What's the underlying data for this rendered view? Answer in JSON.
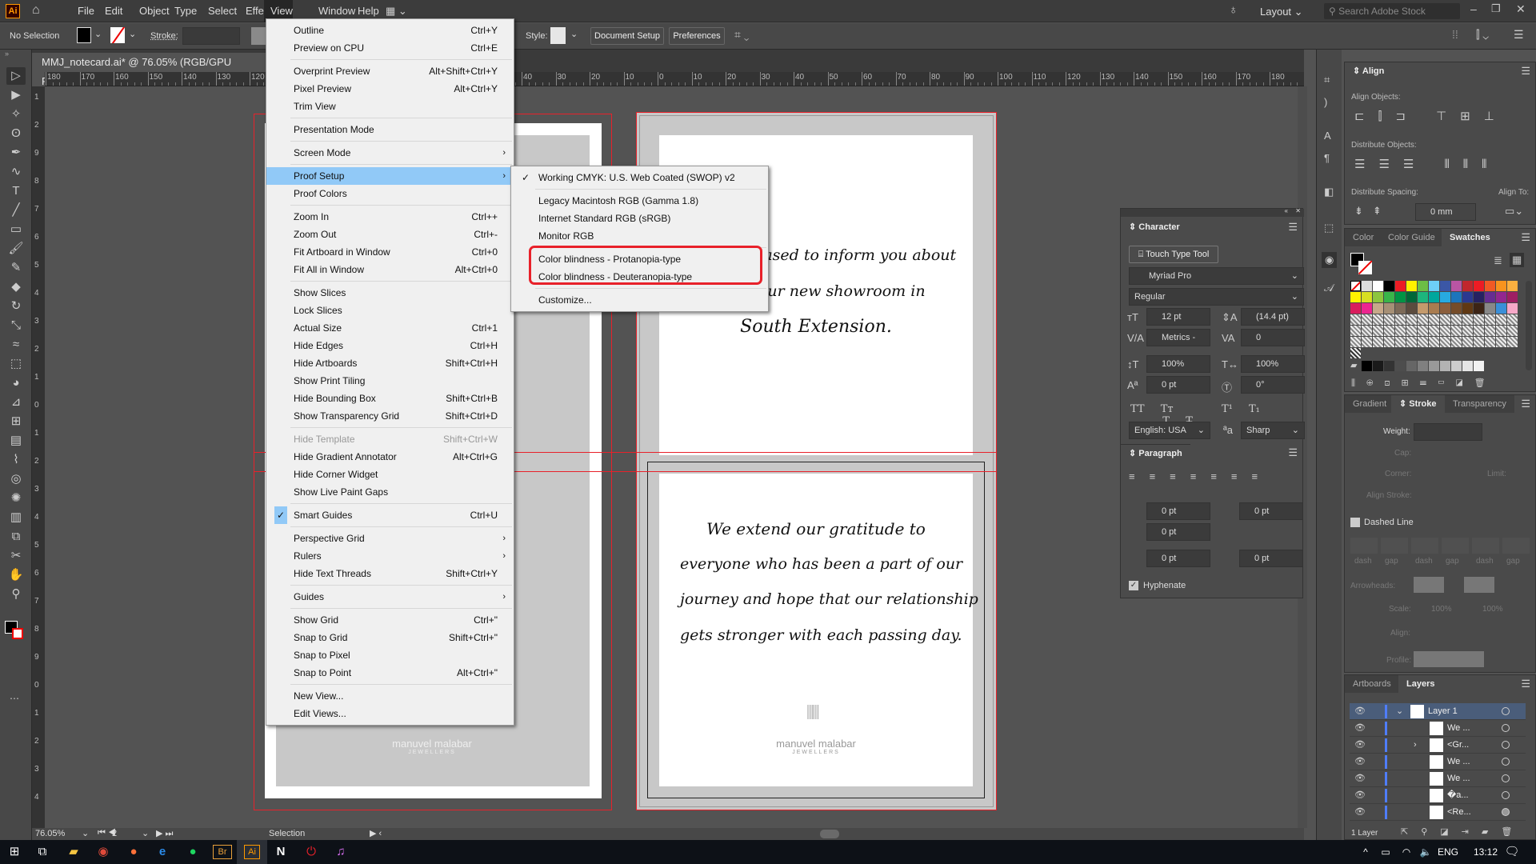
{
  "app": {
    "logo": "Ai",
    "menus": [
      "File",
      "Edit",
      "Object",
      "Type",
      "Select",
      "Effect",
      "View",
      "Window",
      "Help"
    ],
    "active_menu": "View",
    "layout_label": "Layout",
    "search_placeholder": "Search Adobe Stock"
  },
  "control": {
    "selection": "No Selection",
    "stroke_label": "Stroke:",
    "style_label": "Style:",
    "document_setup": "Document Setup",
    "preferences": "Preferences"
  },
  "document": {
    "tab_title": "MMJ_notecard.ai* @ 76.05% (RGB/GPU Preview)",
    "close": "×"
  },
  "rulers": {
    "h_labels": [
      "180",
      "170",
      "160",
      "150",
      "140",
      "130",
      "120",
      "110",
      "100",
      "90",
      "80",
      "70",
      "60",
      "50",
      "40",
      "30",
      "20",
      "10",
      "0",
      "10",
      "20",
      "30",
      "40",
      "50",
      "60",
      "70",
      "80",
      "90",
      "100",
      "110",
      "120",
      "130",
      "140",
      "150",
      "160",
      "170",
      "180",
      "190"
    ],
    "v_labels": [
      "1",
      "2",
      "9",
      "8",
      "7",
      "6",
      "5",
      "4",
      "3",
      "2",
      "1",
      "0",
      "1",
      "2",
      "3",
      "4",
      "5",
      "6",
      "7",
      "8",
      "9",
      "0",
      "1",
      "2",
      "3",
      "4"
    ]
  },
  "tools": [
    "selection-tool",
    "direct-selection-tool",
    "magic-wand-tool",
    "lasso-tool",
    "pen-tool",
    "curvature-tool",
    "type-tool",
    "line-tool",
    "rectangle-tool",
    "paintbrush-tool",
    "blob-brush-tool",
    "eraser-tool",
    "rotate-tool",
    "scale-tool",
    "warp-tool",
    "free-transform-tool",
    "shape-builder-tool",
    "perspective-grid-tool",
    "mesh-tool",
    "gradient-tool",
    "eyedropper-tool",
    "blend-tool",
    "symbol-sprayer-tool",
    "column-graph-tool",
    "artboard-tool",
    "slice-tool",
    "hand-tool",
    "zoom-tool"
  ],
  "artwork": {
    "top_text": [
      "pleased to inform you about",
      "of our new showroom in",
      "South Extension."
    ],
    "bottom_text": [
      "We extend our gratitude to",
      "everyone who has been a part of our",
      "journey and hope that our relationship",
      "gets stronger with each passing day."
    ],
    "logo_name": "manuvel malabar",
    "logo_sub": "JEWELLERS"
  },
  "view_menu": [
    {
      "label": "Outline",
      "shortcut": "Ctrl+Y"
    },
    {
      "label": "Preview on CPU",
      "shortcut": "Ctrl+E"
    },
    {
      "sep": true
    },
    {
      "label": "Overprint Preview",
      "shortcut": "Alt+Shift+Ctrl+Y"
    },
    {
      "label": "Pixel Preview",
      "shortcut": "Alt+Ctrl+Y"
    },
    {
      "label": "Trim View"
    },
    {
      "sep": true
    },
    {
      "label": "Presentation Mode"
    },
    {
      "sep": true
    },
    {
      "label": "Screen Mode",
      "submenu": true
    },
    {
      "sep": true
    },
    {
      "label": "Proof Setup",
      "submenu": true,
      "highlighted": true
    },
    {
      "label": "Proof Colors"
    },
    {
      "sep": true
    },
    {
      "label": "Zoom In",
      "shortcut": "Ctrl++"
    },
    {
      "label": "Zoom Out",
      "shortcut": "Ctrl+-"
    },
    {
      "label": "Fit Artboard in Window",
      "shortcut": "Ctrl+0"
    },
    {
      "label": "Fit All in Window",
      "shortcut": "Alt+Ctrl+0"
    },
    {
      "sep": true
    },
    {
      "label": "Show Slices"
    },
    {
      "label": "Lock Slices"
    },
    {
      "label": "Actual Size",
      "shortcut": "Ctrl+1"
    },
    {
      "label": "Hide Edges",
      "shortcut": "Ctrl+H"
    },
    {
      "label": "Hide Artboards",
      "shortcut": "Shift+Ctrl+H"
    },
    {
      "label": "Show Print Tiling"
    },
    {
      "label": "Hide Bounding Box",
      "shortcut": "Shift+Ctrl+B"
    },
    {
      "label": "Show Transparency Grid",
      "shortcut": "Shift+Ctrl+D"
    },
    {
      "sep": true
    },
    {
      "label": "Hide Template",
      "shortcut": "Shift+Ctrl+W",
      "disabled": true
    },
    {
      "label": "Hide Gradient Annotator",
      "shortcut": "Alt+Ctrl+G"
    },
    {
      "label": "Hide Corner Widget"
    },
    {
      "label": "Show Live Paint Gaps"
    },
    {
      "sep": true
    },
    {
      "label": "Smart Guides",
      "shortcut": "Ctrl+U",
      "checked": true
    },
    {
      "sep": true
    },
    {
      "label": "Perspective Grid",
      "submenu": true
    },
    {
      "label": "Rulers",
      "submenu": true
    },
    {
      "label": "Hide Text Threads",
      "shortcut": "Shift+Ctrl+Y"
    },
    {
      "sep": true
    },
    {
      "label": "Guides",
      "submenu": true
    },
    {
      "sep": true
    },
    {
      "label": "Show Grid",
      "shortcut": "Ctrl+\""
    },
    {
      "label": "Snap to Grid",
      "shortcut": "Shift+Ctrl+\""
    },
    {
      "label": "Snap to Pixel"
    },
    {
      "label": "Snap to Point",
      "shortcut": "Alt+Ctrl+\""
    },
    {
      "sep": true
    },
    {
      "label": "New View..."
    },
    {
      "label": "Edit Views..."
    }
  ],
  "proof_setup_menu": [
    {
      "label": "Working CMYK: U.S. Web Coated (SWOP) v2",
      "checked": true
    },
    {
      "sep": true
    },
    {
      "label": "Legacy Macintosh RGB (Gamma 1.8)"
    },
    {
      "label": "Internet Standard RGB (sRGB)"
    },
    {
      "label": "Monitor RGB"
    },
    {
      "sep": true
    },
    {
      "label": "Color blindness - Protanopia-type"
    },
    {
      "label": "Color blindness - Deuteranopia-type"
    },
    {
      "sep": true
    },
    {
      "label": "Customize..."
    }
  ],
  "highlight_color": "#e8212a",
  "align_panel": {
    "title": "Align",
    "align_objects": "Align Objects:",
    "distribute_objects": "Distribute Objects:",
    "distribute_spacing": "Distribute Spacing:",
    "align_to": "Align To:",
    "spacing_value": "0 mm"
  },
  "swatches_panel": {
    "tabs": [
      "Color",
      "Color Guide",
      "Swatches"
    ],
    "active": "Swatches",
    "colors": [
      "#ffffff",
      "#000000",
      "#ed1c24",
      "#fff200",
      "#6cbe45",
      "#6dcff6",
      "#3b57a6",
      "#b955a4",
      "#c1272d",
      "#ed1c24",
      "#f15a24",
      "#f7931e",
      "#fbb040",
      "#fff200",
      "#d7df23",
      "#8dc63f",
      "#39b54a",
      "#009444",
      "#006838",
      "#1cb67d",
      "#00a79d",
      "#27aae1",
      "#1c75bc",
      "#2b3990",
      "#262262",
      "#662d91",
      "#92278f",
      "#9e1f63",
      "#d91c5c",
      "#ec268f",
      "#c7a98a",
      "#a69076",
      "#7c6a58",
      "#5b4b3e",
      "#c49a6c",
      "#a97c50",
      "#8b5e3c",
      "#754c29",
      "#603813",
      "#3c2415",
      "#888888",
      "#3a8fd8",
      "#f7a8c8"
    ],
    "grays": [
      "#000000",
      "#1a1a1a",
      "#333333",
      "#4d4d4d",
      "#666666",
      "#808080",
      "#999999",
      "#b3b3b3",
      "#cccccc",
      "#e6e6e6",
      "#f2f2f2"
    ]
  },
  "character_panel": {
    "title": "Character",
    "touch_type": "Touch Type Tool",
    "font": "Myriad Pro",
    "style": "Regular",
    "size": "12 pt",
    "leading": "(14.4 pt)",
    "kerning": "Metrics -",
    "tracking": "0",
    "vscale": "100%",
    "hscale": "100%",
    "baseline": "0 pt",
    "rotation": "0°",
    "language": "English: USA",
    "antialias": "Sharp"
  },
  "paragraph_panel": {
    "title": "Paragraph",
    "left_indent": "0 pt",
    "right_indent": "0 pt",
    "first_indent": "0 pt",
    "space_before": "0 pt",
    "space_after": "0 pt",
    "hyphenate": "Hyphenate",
    "hyphenate_checked": true
  },
  "stroke_panel": {
    "tabs": [
      "Gradient",
      "Stroke",
      "Transparency"
    ],
    "active": "Stroke",
    "weight": "Weight:",
    "cap": "Cap:",
    "corner": "Corner:",
    "limit": "Limit:",
    "align_stroke": "Align Stroke:",
    "dashed_line": "Dashed Line",
    "dash_labels": [
      "dash",
      "gap",
      "dash",
      "gap",
      "dash",
      "gap"
    ],
    "arrowheads": "Arrowheads:",
    "scale": "Scale:",
    "scale1": "100%",
    "scale2": "100%",
    "align": "Align:",
    "profile": "Profile:"
  },
  "layers_panel": {
    "tabs": [
      "Artboards",
      "Layers"
    ],
    "active": "Layers",
    "rows": [
      {
        "name": "Layer 1",
        "top": true
      },
      {
        "name": "We ..."
      },
      {
        "name": "<Gr...",
        "expand": true
      },
      {
        "name": "We ..."
      },
      {
        "name": "We ..."
      },
      {
        "name": "�a..."
      },
      {
        "name": "<Re...",
        "selected_dot": true
      }
    ],
    "count": "1 Layer",
    "layer_color": "#4f7df9"
  },
  "status": {
    "zoom": "76.05%",
    "artboard": "2",
    "tool": "Selection"
  },
  "taskbar": {
    "apps": [
      "windows-start",
      "task-view",
      "file-explorer",
      "chrome",
      "firefox",
      "edge",
      "spotify",
      "bridge",
      "illustrator",
      "notion",
      "power-app",
      "itunes"
    ],
    "language": "ENG",
    "time": "13:12"
  }
}
